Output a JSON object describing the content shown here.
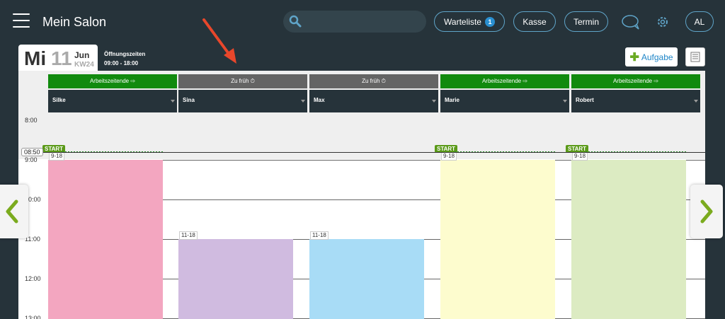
{
  "header": {
    "app_title": "Mein Salon",
    "search": {
      "value": "",
      "placeholder": "",
      "icon": "search-icon"
    },
    "waitlist": {
      "label": "Warteliste",
      "count": "1"
    },
    "checkout_label": "Kasse",
    "appointment_label": "Termin",
    "user_initials": "AL",
    "colors": {
      "bar_bg": "#26333a",
      "pill_border": "#5fa4c8",
      "badge": "#2a8fd0"
    }
  },
  "date": {
    "weekday": "Mi",
    "day": "11",
    "month": "Jun",
    "week": "KW24",
    "hours_label": "Öffnungszeiten",
    "hours_value": "09:00 - 18:00"
  },
  "toolbar": {
    "task_label": "Aufgabe"
  },
  "timeline": {
    "hours": [
      "8:00",
      "9:00",
      "10:00",
      "11:00",
      "12:00",
      "13:00"
    ],
    "now": "08:50",
    "start_label": "START"
  },
  "staff": [
    {
      "name": "Silke",
      "status": "Arbeitszeitende ⇨",
      "status_type": "ok",
      "shift": "9-18",
      "color": "#f3a6c0",
      "started": true
    },
    {
      "name": "Sina",
      "status": "Zu früh ⏱",
      "status_type": "early",
      "shift": "11-18",
      "color": "#d0bbe0",
      "started": false
    },
    {
      "name": "Max",
      "status": "Zu früh ⏱",
      "status_type": "early",
      "shift": "11-18",
      "color": "#a8dcf6",
      "started": false
    },
    {
      "name": "Marie",
      "status": "Arbeitszeitende ⇨",
      "status_type": "ok",
      "shift": "9-18",
      "color": "#fdfcce",
      "started": true
    },
    {
      "name": "Robert",
      "status": "Arbeitszeitende ⇨",
      "status_type": "ok",
      "shift": "9-18",
      "color": "#dcebc2",
      "started": true
    }
  ]
}
